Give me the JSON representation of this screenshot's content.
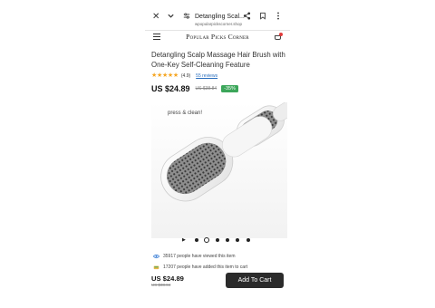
{
  "browser": {
    "page_title": "Detangling Scal...",
    "host": "wpopularpickscorner.shop",
    "icons": [
      "close-icon",
      "chevron-down-icon",
      "tune-icon",
      "share-icon",
      "bookmark-icon",
      "more-vert-icon"
    ]
  },
  "store": {
    "brand": "Popular Picks Corner",
    "icons": [
      "hamburger-menu-icon",
      "cart-icon"
    ]
  },
  "product": {
    "title": "Detangling Scalp Massage Hair Brush with One-Key Self-Cleaning Feature",
    "stars": "★★★★★",
    "rating": 4.9,
    "rating_label": "(4.9)",
    "reviews_label": "55 reviews",
    "price": "US $24.89",
    "old_price": "US $38.84",
    "discount": "-35%",
    "image_caption": "press & clean!"
  },
  "carousel": {
    "slide_count": 6,
    "active_index": 1
  },
  "social_proof": {
    "viewed": "35917 people have viewed this item",
    "added": "17207 people have added this item to cart"
  },
  "bottom_bar": {
    "price": "US $24.89",
    "old_price": "US $38.84",
    "add_to_cart_label": "Add To Cart"
  },
  "colors": {
    "accent_dark": "#2b2b2b",
    "discount_green": "#3ca65a",
    "star_gold": "#f5a623",
    "link_blue": "#2a6ebd",
    "cart_badge_red": "#e23b3b"
  }
}
